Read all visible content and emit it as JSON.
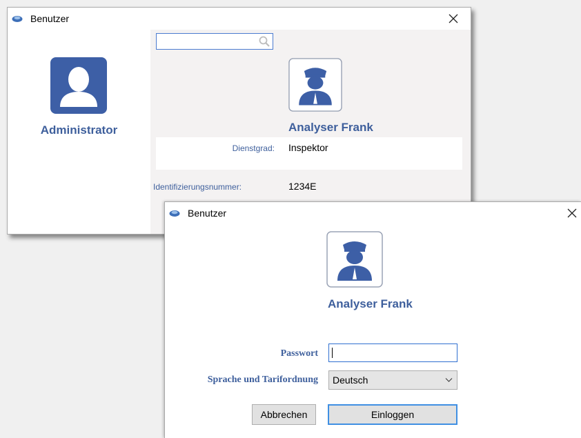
{
  "user_list_window": {
    "title": "Benutzer",
    "users": [
      {
        "name": "Administrator",
        "avatar_icon": "user-silhouette-icon"
      }
    ],
    "search": {
      "value": "",
      "icon": "search-icon"
    },
    "selected_user": {
      "name": "Analyser Frank",
      "avatar_icon": "police-officer-icon",
      "fields": [
        {
          "label": "Dienstgrad:",
          "value": "Inspektor"
        },
        {
          "label": "Identifizierungsnummer:",
          "value": "1234E"
        }
      ]
    }
  },
  "login_window": {
    "title": "Benutzer",
    "user_name": "Analyser Frank",
    "avatar_icon": "police-officer-icon",
    "password": {
      "label": "Passwort",
      "value": ""
    },
    "language": {
      "label": "Sprache und Tarifordnung",
      "selected": "Deutsch"
    },
    "buttons": {
      "cancel": "Abbrechen",
      "login": "Einloggen"
    }
  },
  "colors": {
    "accent_blue": "#3e5f9c",
    "avatar_fill": "#3d5fa6",
    "focus_border": "#2f6fd0"
  }
}
